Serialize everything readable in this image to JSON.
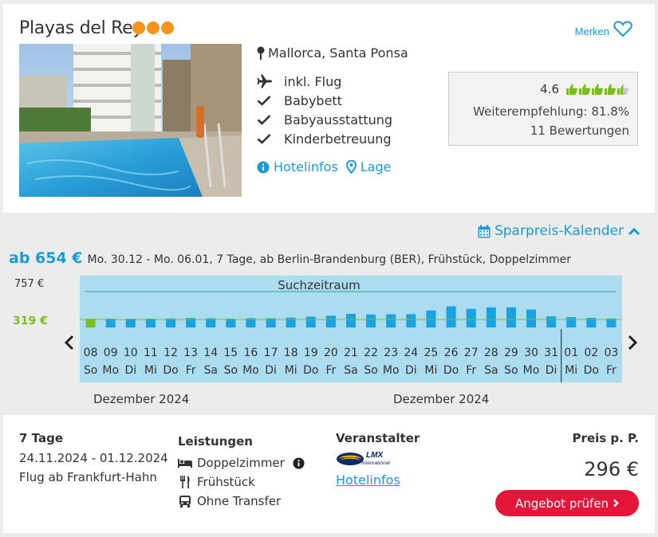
{
  "hotel": {
    "name": "Playas del Rey",
    "stars": 3,
    "merken_label": "Merken",
    "location": "Mallorca, Santa Ponsa",
    "features": [
      {
        "icon": "plane-icon",
        "label": "inkl. Flug"
      },
      {
        "icon": "check-icon",
        "label": "Babybett"
      },
      {
        "icon": "check-icon",
        "label": "Babyausstattung"
      },
      {
        "icon": "check-icon",
        "label": "Kinderbetreuung"
      }
    ],
    "links": {
      "hotelinfos": "Hotelinfos",
      "lage": "Lage"
    },
    "rating": {
      "score": "4.6",
      "thumbs_filled": 4.5,
      "thumbs_total": 5,
      "recommendation": "Weiterempfehlung: 81.8%",
      "reviews": "11 Bewertungen"
    }
  },
  "calendar": {
    "toggle_label": "Sparpreis-Kalender",
    "price_from": "ab 654 €",
    "trip_description": "Mo. 30.12 - Mo. 06.01, 7 Tage, ab Berlin-Brandenburg (BER), Frühstück, Doppelzimmer",
    "months": [
      "Dezember 2024",
      "Dezember 2024"
    ]
  },
  "chart_data": {
    "type": "bar",
    "title": "Suchzeitraum",
    "y_max_label": "757 €",
    "y_min_label": "319 €",
    "ylim": [
      319,
      757
    ],
    "categories": [
      "08",
      "09",
      "10",
      "11",
      "12",
      "13",
      "14",
      "15",
      "16",
      "17",
      "18",
      "19",
      "20",
      "21",
      "22",
      "23",
      "24",
      "25",
      "26",
      "27",
      "28",
      "29",
      "30",
      "31",
      "01",
      "02",
      "03"
    ],
    "weekdays": [
      "So",
      "Mo",
      "Di",
      "Mi",
      "Do",
      "Fr",
      "Sa",
      "So",
      "Mo",
      "Di",
      "Mi",
      "Do",
      "Fr",
      "Sa",
      "So",
      "Mo",
      "Di",
      "Mi",
      "Do",
      "Fr",
      "Sa",
      "So",
      "Mo",
      "Di",
      "Mi",
      "Do",
      "Fr"
    ],
    "values": [
      331,
      331,
      331,
      331,
      335,
      341,
      338,
      333,
      339,
      338,
      348,
      363,
      378,
      408,
      398,
      400,
      403,
      462,
      525,
      485,
      509,
      511,
      475,
      368,
      357,
      344,
      334
    ],
    "highlighted_index": 0,
    "colors": {
      "bar": "#16a2e3",
      "highlight": "#7bbd1f",
      "band": "#acdcf0",
      "min_line": "#7bbd1f",
      "top_line": "#2aa89a"
    }
  },
  "offer": {
    "duration_head": "7 Tage",
    "dates": "24.11.2024 - 01.12.2024",
    "flight": "Flug ab Frankfurt-Hahn",
    "services_head": "Leistungen",
    "services": [
      {
        "icon": "bed-icon",
        "label": "Doppelzimmer"
      },
      {
        "icon": "cutlery-icon",
        "label": "Frühstück"
      },
      {
        "icon": "bus-icon",
        "label": "Ohne Transfer"
      }
    ],
    "operator_head": "Veranstalter",
    "operator_logo_text": "LMX International",
    "operator_link": "Hotelinfos",
    "price_head": "Preis p. P.",
    "price": "296 €",
    "cta": "Angebot prüfen"
  }
}
